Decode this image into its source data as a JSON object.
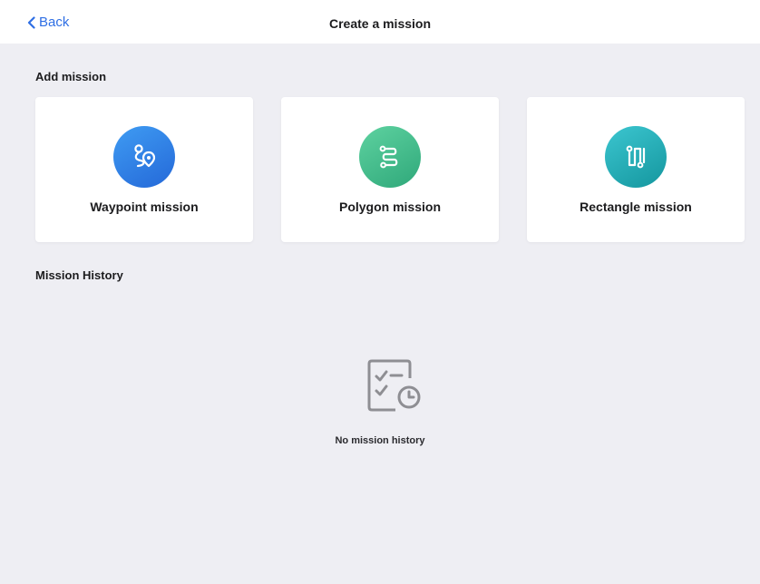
{
  "nav": {
    "back_label": "Back",
    "title": "Create a mission"
  },
  "add_section": {
    "title": "Add mission",
    "cards": [
      {
        "label": "Waypoint mission",
        "icon": "waypoint-route-icon",
        "color": "#2f7fe6"
      },
      {
        "label": "Polygon mission",
        "icon": "polygon-route-icon",
        "color": "#3fbf8c"
      },
      {
        "label": "Rectangle mission",
        "icon": "rectangle-route-icon",
        "color": "#1fb0b8"
      }
    ]
  },
  "history_section": {
    "title": "Mission History",
    "empty_icon": "checklist-clock-icon",
    "empty_text": "No mission history"
  },
  "colors": {
    "accent": "#2f6fe4",
    "background": "#eeeef3"
  }
}
